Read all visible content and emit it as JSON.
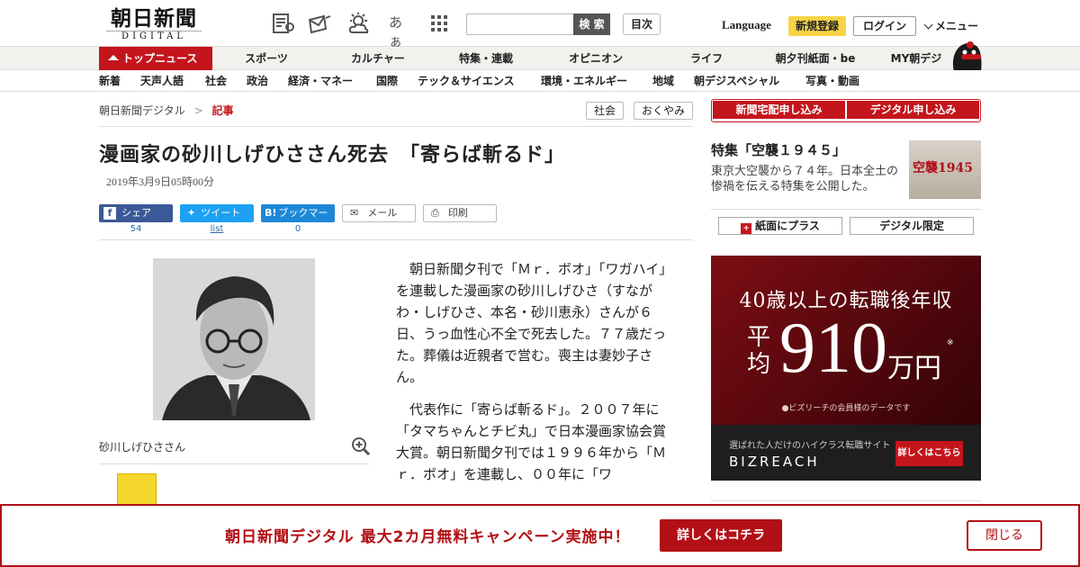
{
  "header": {
    "logo_main": "朝日新聞",
    "logo_sub": "DIGITAL",
    "icons": [
      "newspaper-icon",
      "email-news-icon",
      "weather-icon",
      "font-size-icon",
      "grid-menu-icon"
    ],
    "font_label": "あぁ",
    "search_placeholder": "",
    "search_button": "検 索",
    "index_button": "目次",
    "language": "Language",
    "register": "新規登録",
    "login": "ログイン",
    "menu": "メニュー"
  },
  "nav1": {
    "top": "トップニュース",
    "items": [
      "スポーツ",
      "カルチャー",
      "特集・連載",
      "オピニオン",
      "ライフ",
      "朝夕刊紙面・be",
      "MY朝デジ"
    ]
  },
  "nav2": {
    "items": [
      "新着",
      "天声人語",
      "社会",
      "政治",
      "経済・マネー",
      "国際",
      "テック＆サイエンス",
      "環境・エネルギー",
      "地域",
      "朝デジスペシャル",
      "写真・動画"
    ]
  },
  "breadcrumb": {
    "home": "朝日新聞デジタル",
    "sep": ">",
    "current": "記事"
  },
  "tags": [
    "社会",
    "おくやみ"
  ],
  "article": {
    "title": "漫画家の砂川しげひささん死去　「寄らば斬るド」",
    "date": "2019年3月9日05時00分",
    "share": {
      "facebook": "シェア",
      "facebook_count": "54",
      "twitter": "ツイート",
      "twitter_count": "list",
      "hatena": "ブックマーク",
      "hatena_count": "0",
      "mail": "メール",
      "print": "印刷"
    },
    "photo_caption": "砂川しげひささん",
    "paragraphs": [
      "朝日新聞夕刊で「Ｍｒ．ボオ」「ワガハイ」を連載した漫画家の砂川しげひさ（すながわ・しげひさ、本名・砂川恵永）さんが６日、うっ血性心不全で死去した。７７歳だった。葬儀は近親者で営む。喪主は妻妙子さん。",
      "代表作に「寄らば斬るド」。２００７年に「タマちゃんとチビ丸」で日本漫画家協会賞大賞。朝日新聞夕刊では１９９６年から「Ｍｒ．ボオ」を連載し、００年に「ワ"
    ]
  },
  "sidebar": {
    "subscribe_paper": "新聞宅配申し込み",
    "subscribe_digital": "デジタル申し込み",
    "feature_title": "特集「空襲１９４５」",
    "feature_text": "東京大空襲から７４年。日本全土の惨禍を伝える特集を公開した。",
    "feature_thumb_text": "空襲1945",
    "plus_button": "紙面にプラス",
    "digital_only": "デジタル限定"
  },
  "ad": {
    "headline": "40歳以上の転職後年収",
    "prefix1": "平",
    "prefix2": "均",
    "amount": "910",
    "unit": "万円",
    "note_mark": "※",
    "footnote": "●ビズリーチの会員様のデータです",
    "tagline": "選ばれた人だけのハイクラス転職サイト",
    "brand": "BIZREACH",
    "cta": "詳しくはこちら"
  },
  "banner": {
    "text": "朝日新聞デジタル 最大2カ月無料キャンペーン実施中！",
    "cta": "詳しくはコチラ",
    "close": "閉じる"
  },
  "colors": {
    "brand_red": "#c4151c",
    "register_yellow": "#f6d445",
    "link_blue": "#2c6aa6"
  }
}
